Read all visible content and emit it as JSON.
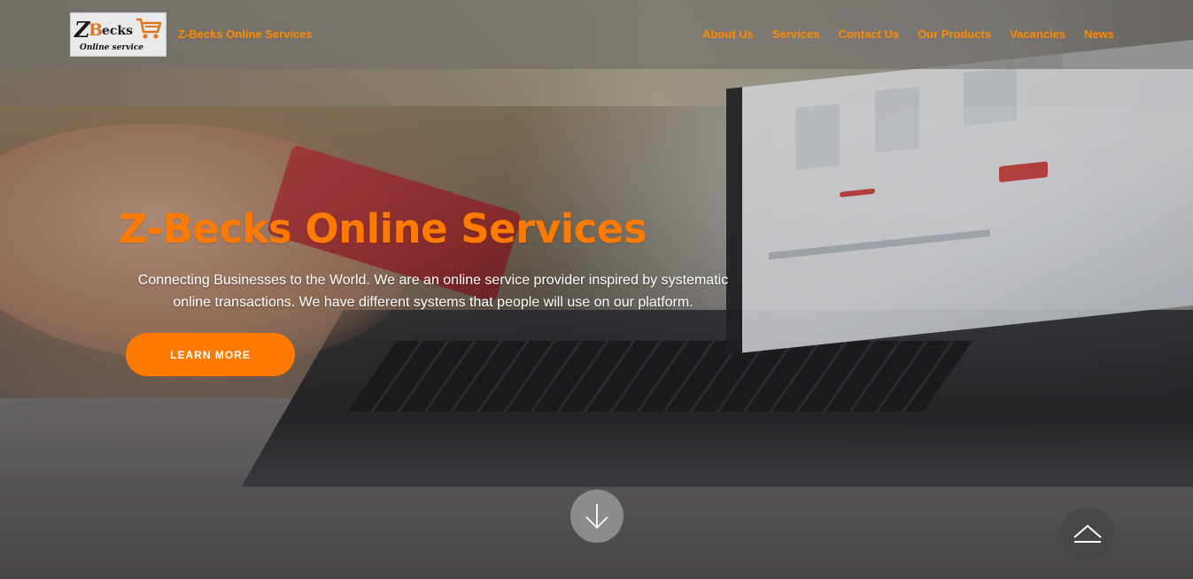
{
  "header": {
    "logo": {
      "mark_z": "Z",
      "mark_b": "B",
      "mark_ecks": "ecks",
      "subtitle": "Online service"
    },
    "brand_name": "Z-Becks Online Services",
    "nav": [
      {
        "label": "About Us"
      },
      {
        "label": "Services"
      },
      {
        "label": "Contact Us"
      },
      {
        "label": "Our Products"
      },
      {
        "label": "Vacancies"
      },
      {
        "label": "News"
      }
    ]
  },
  "hero": {
    "title": "Z-Becks Online Services",
    "text": "Connecting Businesses to the World. We are an online service provider inspired by systematic online transactions. We have different systems that people will use on our platform.",
    "cta_label": "LEARN MORE"
  },
  "controls": {
    "scroll_down_icon": "arrow-down-icon",
    "scroll_top_icon": "chevron-up-icon"
  },
  "colors": {
    "accent": "#ff7a00",
    "nav_text": "#ff8a00",
    "white": "#ffffff"
  }
}
